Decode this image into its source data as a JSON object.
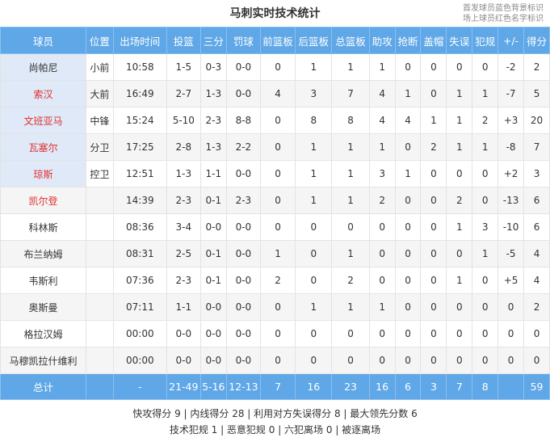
{
  "title": "马刺实时技术统计",
  "legend": {
    "line1": "首发球员蓝色背景标识",
    "line2": "场上球员红色名字标识"
  },
  "headers": [
    "球员",
    "位置",
    "出场时间",
    "投篮",
    "三分",
    "罚球",
    "前篮板",
    "后篮板",
    "总篮板",
    "助攻",
    "抢断",
    "盖帽",
    "失误",
    "犯规",
    "+/-",
    "得分"
  ],
  "players": [
    {
      "name": "尚帕尼",
      "pos": "小前",
      "min": "10:58",
      "fg": "1-5",
      "tp": "0-3",
      "ft": "0-0",
      "oreb": "0",
      "dreb": "1",
      "reb": "1",
      "ast": "1",
      "stl": "0",
      "blk": "0",
      "to": "0",
      "pf": "0",
      "pm": "-2",
      "pts": "2",
      "starter": true,
      "on_court": false
    },
    {
      "name": "索汉",
      "pos": "大前",
      "min": "16:49",
      "fg": "2-7",
      "tp": "1-3",
      "ft": "0-0",
      "oreb": "4",
      "dreb": "3",
      "reb": "7",
      "ast": "4",
      "stl": "1",
      "blk": "0",
      "to": "1",
      "pf": "1",
      "pm": "-7",
      "pts": "5",
      "starter": true,
      "on_court": true
    },
    {
      "name": "文班亚马",
      "pos": "中锋",
      "min": "15:24",
      "fg": "5-10",
      "tp": "2-3",
      "ft": "8-8",
      "oreb": "0",
      "dreb": "8",
      "reb": "8",
      "ast": "4",
      "stl": "4",
      "blk": "1",
      "to": "1",
      "pf": "2",
      "pm": "+3",
      "pts": "20",
      "starter": true,
      "on_court": true
    },
    {
      "name": "瓦塞尔",
      "pos": "分卫",
      "min": "17:25",
      "fg": "2-8",
      "tp": "1-3",
      "ft": "2-2",
      "oreb": "0",
      "dreb": "1",
      "reb": "1",
      "ast": "1",
      "stl": "0",
      "blk": "2",
      "to": "1",
      "pf": "1",
      "pm": "-8",
      "pts": "7",
      "starter": true,
      "on_court": true
    },
    {
      "name": "琼斯",
      "pos": "控卫",
      "min": "12:51",
      "fg": "1-3",
      "tp": "1-1",
      "ft": "0-0",
      "oreb": "0",
      "dreb": "1",
      "reb": "1",
      "ast": "3",
      "stl": "1",
      "blk": "0",
      "to": "0",
      "pf": "0",
      "pm": "+2",
      "pts": "3",
      "starter": true,
      "on_court": true
    },
    {
      "name": "凯尔登",
      "pos": "",
      "min": "14:39",
      "fg": "2-3",
      "tp": "0-1",
      "ft": "2-3",
      "oreb": "0",
      "dreb": "1",
      "reb": "1",
      "ast": "2",
      "stl": "0",
      "blk": "0",
      "to": "2",
      "pf": "0",
      "pm": "-13",
      "pts": "6",
      "starter": false,
      "on_court": true
    },
    {
      "name": "科林斯",
      "pos": "",
      "min": "08:36",
      "fg": "3-4",
      "tp": "0-0",
      "ft": "0-0",
      "oreb": "0",
      "dreb": "0",
      "reb": "0",
      "ast": "0",
      "stl": "0",
      "blk": "0",
      "to": "1",
      "pf": "3",
      "pm": "-10",
      "pts": "6",
      "starter": false,
      "on_court": false
    },
    {
      "name": "布兰纳姆",
      "pos": "",
      "min": "08:31",
      "fg": "2-5",
      "tp": "0-1",
      "ft": "0-0",
      "oreb": "1",
      "dreb": "0",
      "reb": "1",
      "ast": "0",
      "stl": "0",
      "blk": "0",
      "to": "0",
      "pf": "1",
      "pm": "-5",
      "pts": "4",
      "starter": false,
      "on_court": false
    },
    {
      "name": "韦斯利",
      "pos": "",
      "min": "07:36",
      "fg": "2-3",
      "tp": "0-1",
      "ft": "0-0",
      "oreb": "2",
      "dreb": "0",
      "reb": "2",
      "ast": "0",
      "stl": "0",
      "blk": "0",
      "to": "1",
      "pf": "0",
      "pm": "+5",
      "pts": "4",
      "starter": false,
      "on_court": false
    },
    {
      "name": "奥斯曼",
      "pos": "",
      "min": "07:11",
      "fg": "1-1",
      "tp": "0-0",
      "ft": "0-0",
      "oreb": "0",
      "dreb": "1",
      "reb": "1",
      "ast": "1",
      "stl": "0",
      "blk": "0",
      "to": "0",
      "pf": "0",
      "pm": "0",
      "pts": "2",
      "starter": false,
      "on_court": false
    },
    {
      "name": "格拉汉姆",
      "pos": "",
      "min": "00:00",
      "fg": "0-0",
      "tp": "0-0",
      "ft": "0-0",
      "oreb": "0",
      "dreb": "0",
      "reb": "0",
      "ast": "0",
      "stl": "0",
      "blk": "0",
      "to": "0",
      "pf": "0",
      "pm": "0",
      "pts": "0",
      "starter": false,
      "on_court": false
    },
    {
      "name": "马穆凯拉什维利",
      "pos": "",
      "min": "00:00",
      "fg": "0-0",
      "tp": "0-0",
      "ft": "0-0",
      "oreb": "0",
      "dreb": "0",
      "reb": "0",
      "ast": "0",
      "stl": "0",
      "blk": "0",
      "to": "0",
      "pf": "0",
      "pm": "0",
      "pts": "0",
      "starter": false,
      "on_court": false
    }
  ],
  "totals": {
    "name": "总计",
    "pos": "",
    "min": "-",
    "fg": "21-49",
    "tp": "5-16",
    "ft": "12-13",
    "oreb": "7",
    "dreb": "16",
    "reb": "23",
    "ast": "16",
    "stl": "6",
    "blk": "3",
    "to": "7",
    "pf": "8",
    "pm": "",
    "pts": "59"
  },
  "summary": {
    "line1": "快攻得分 9 | 内线得分 28 | 利用对方失误得分 8 | 最大领先分数 6",
    "line2": "技术犯规 1 | 恶意犯规 0 | 六犯离场 0 | 被逐离场"
  },
  "colors": {
    "header_bg": "#5fa7e6",
    "starter_bg": "#dfe9f8",
    "on_court_text": "#e03030"
  }
}
